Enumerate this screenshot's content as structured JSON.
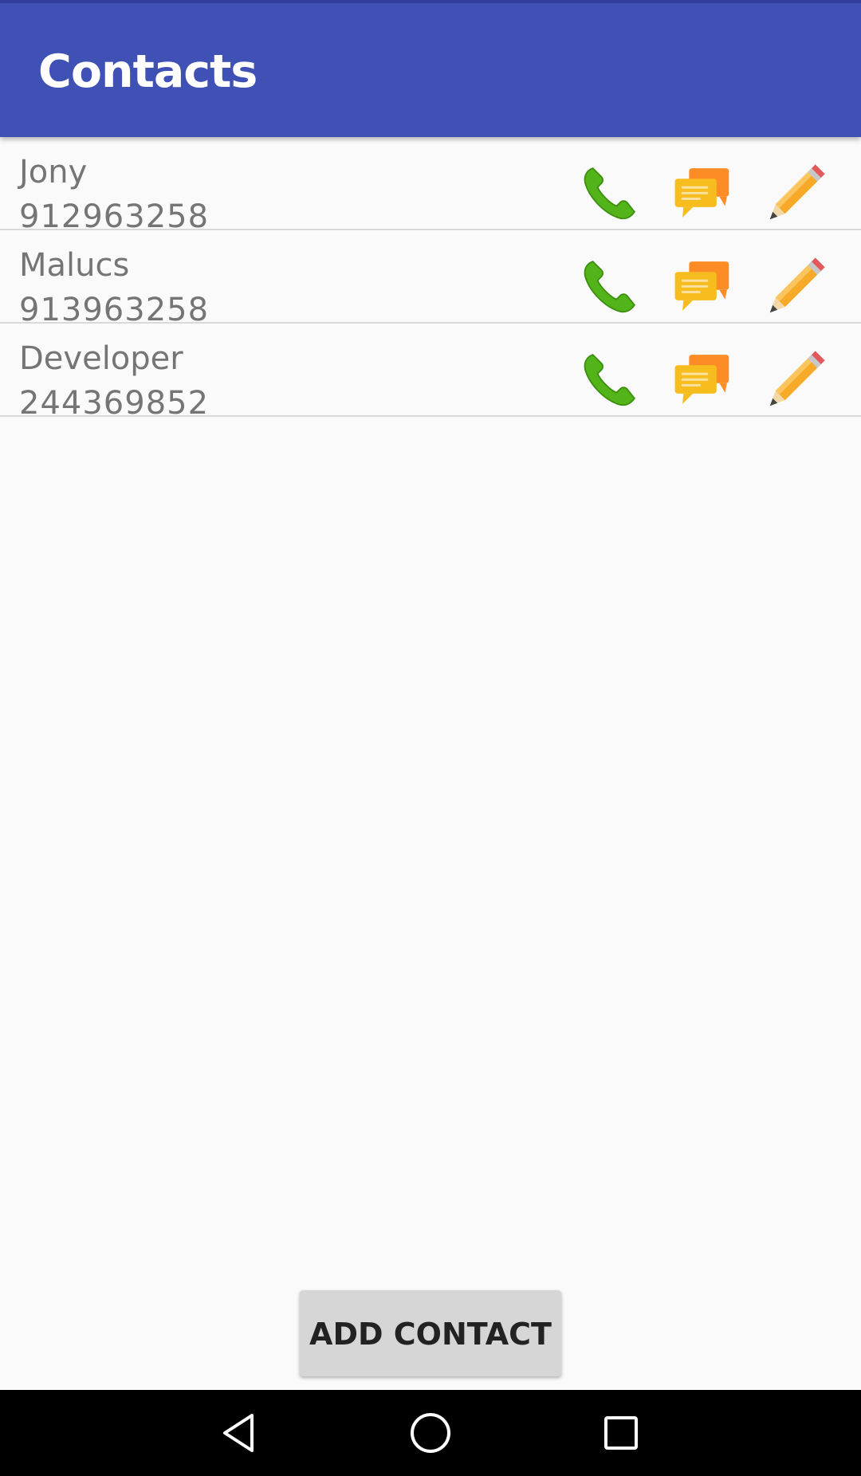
{
  "app_bar": {
    "title": "Contacts",
    "color": "#3f51b5"
  },
  "contacts": [
    {
      "name": "Jony",
      "number": "912963258"
    },
    {
      "name": "Malucs",
      "number": "913963258"
    },
    {
      "name": "Developer",
      "number": "244369852"
    }
  ],
  "row_actions": {
    "call_icon": "phone-icon",
    "message_icon": "chat-bubbles-icon",
    "edit_icon": "pencil-icon"
  },
  "add_button": {
    "label": "ADD CONTACT"
  },
  "nav_bar": {
    "back_icon": "back-triangle-icon",
    "home_icon": "home-circle-icon",
    "recents_icon": "recents-square-icon"
  }
}
